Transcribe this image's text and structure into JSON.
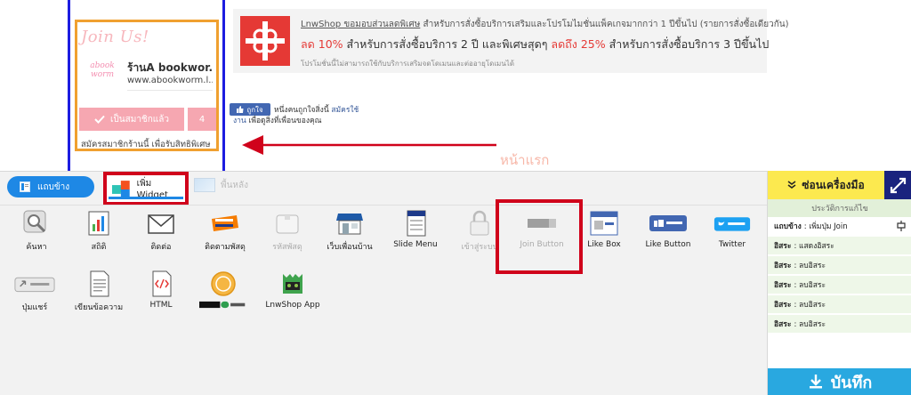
{
  "preview": {
    "join_widget": {
      "title": "Join Us!",
      "logo_text": "abook worm",
      "shop_name": "ร้านA bookwor...",
      "shop_url": "www.abookworm.l...",
      "member_button": "เป็นสมาชิกแล้ว",
      "member_count": "4",
      "note": "สมัครสมาชิกร้านนี้ เพื่อรับสิทธิพิเศษ"
    },
    "promo": {
      "link": "LnwShop ขอมอบส่วนลดพิเศษ",
      "line1_rest": " สำหรับการสั่งซื้อบริการเสริมและโปรโมไมชั่นแพ็คเกจมากกว่า 1 ปีขึ้นไป (รายการสั่งซื้อเดียวกัน)",
      "discount1": "ลด 10%",
      "line2_mid": " สำหรับการสั่งซื้อบริการ 2 ปี   และพิเศษสุดๆ ",
      "discount2": "ลดถึง 25%",
      "line2_end": " สำหรับการสั่งซื้อบริการ 3 ปีขึ้นไป",
      "line3": "โปรโมชั่นนี้ไม่สามารถใช้กับบริการเสริมจดโดเมนและต่ออายุโดเมนได้"
    },
    "facebook_like": {
      "button": "ถูกใจ",
      "text_start": "หนึ่งคนถูกใจสิ่งนี้ ",
      "text_link": "สมัครใช้",
      "sub_link": "งาน",
      "sub_rest": " เพื่อดูสิ่งที่เพื่อนของคุณ"
    },
    "home_label": "หน้าแรก"
  },
  "tabs": {
    "sidebar": "แถบข้าง",
    "add_widget": "เพิ่ม Widget",
    "background": "พื้นหลัง"
  },
  "widgets": [
    {
      "label": "ค้นหา",
      "icon": "magnifier-icon"
    },
    {
      "label": "สถิติ",
      "icon": "statistics-chart-icon"
    },
    {
      "label": "ติดต่อ",
      "icon": "envelope-icon"
    },
    {
      "label": "ติดตามพัสดุ",
      "icon": "track-trace-icon"
    },
    {
      "label": "รหัสพัสดุ",
      "icon": "parcel-box-icon"
    },
    {
      "label": "เว็บเพื่อนบ้าน",
      "icon": "shop-storefront-icon"
    },
    {
      "label": "Slide Menu",
      "icon": "slide-menu-icon"
    },
    {
      "label": "เข้าสู่ระบบ",
      "icon": "padlock-icon"
    },
    {
      "label": "Join Button",
      "icon": "join-button-icon"
    },
    {
      "label": "Like Box",
      "icon": "facebook-like-box-icon"
    },
    {
      "label": "Like Button",
      "icon": "facebook-like-button-icon"
    },
    {
      "label": "Twitter",
      "icon": "twitter-tweet-icon"
    },
    {
      "label": "ปุ่มแชร์",
      "icon": "share-button-icon"
    },
    {
      "label": "เขียนข้อความ",
      "icon": "document-text-icon"
    },
    {
      "label": "HTML",
      "icon": "html-code-icon"
    },
    {
      "label": "",
      "icon": "lnw-mall-coin-icon",
      "label_image": "LNW MALL Ch."
    },
    {
      "label": "LnwShop App",
      "icon": "lnwshop-app-icon"
    }
  ],
  "right_panel": {
    "hide_tools": "ซ่อนเครื่องมือ",
    "history_title": "ประวัติการแก้ไข",
    "history": [
      {
        "bold": "แถบข้าง",
        "rest": ": เพิ่มปุ่ม Join"
      },
      {
        "bold": "อิสระ",
        "rest": ": แสดงอิสระ"
      },
      {
        "bold": "อิสระ",
        "rest": ": ลบอิสระ"
      },
      {
        "bold": "อิสระ",
        "rest": ": ลบอิสระ"
      },
      {
        "bold": "อิสระ",
        "rest": ": ลบอิสระ"
      },
      {
        "bold": "อิสระ",
        "rest": ": ลบอิสระ"
      }
    ],
    "save": "บันทึก"
  },
  "colors": {
    "accent_blue": "#1e88e5",
    "highlight_red": "#d0021b",
    "pink": "#f6a7b1",
    "yellow": "#fce94f",
    "save_blue": "#29a8e0",
    "facebook_blue": "#4267b2"
  }
}
